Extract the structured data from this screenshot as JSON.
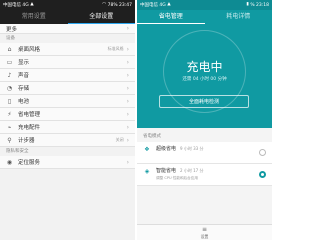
{
  "left": {
    "status": {
      "carrier": "中国电信 4G",
      "right": "78% 23:47"
    },
    "tabs": [
      "常用设置",
      "全部设置"
    ],
    "first_row": "更多",
    "section_device": "设备",
    "items": [
      {
        "label": "桌面风格",
        "value": "标准风格",
        "icon": "home-icon"
      },
      {
        "label": "显示",
        "value": "",
        "icon": "display-icon"
      },
      {
        "label": "声音",
        "value": "",
        "icon": "sound-icon"
      },
      {
        "label": "存储",
        "value": "",
        "icon": "storage-icon"
      },
      {
        "label": "电池",
        "value": "",
        "icon": "battery-icon"
      },
      {
        "label": "省电管理",
        "value": "",
        "icon": "power-saving-icon"
      },
      {
        "label": "充电配件",
        "value": "",
        "icon": "charging-icon"
      },
      {
        "label": "计步器",
        "value": "关闭",
        "icon": "pedometer-icon"
      }
    ],
    "section_privacy": "隐私和安全",
    "last_item": {
      "label": "定位服务",
      "icon": "location-icon"
    }
  },
  "right": {
    "status": {
      "carrier": "中国电信 4G",
      "right": "% 23:18"
    },
    "tabs": [
      "省电管理",
      "耗电详情"
    ],
    "hero_title": "充电中",
    "hero_sub": "还需 04 小时 00 分钟",
    "hero_button": "全面耗电检测",
    "mode_header": "省电模式",
    "modes": [
      {
        "title": "超级省电",
        "time": "9 小时 33 分",
        "desc": "",
        "selected": false
      },
      {
        "title": "智能省电",
        "time": "2 小时 17 分",
        "desc": "调整 CPU 性能和后台应用",
        "selected": true
      }
    ],
    "bottom_label": "设置"
  },
  "colors": {
    "teal": "#109aa2",
    "accent_blue": "#2ea8f0",
    "dark_bar": "#1f1f1f"
  }
}
